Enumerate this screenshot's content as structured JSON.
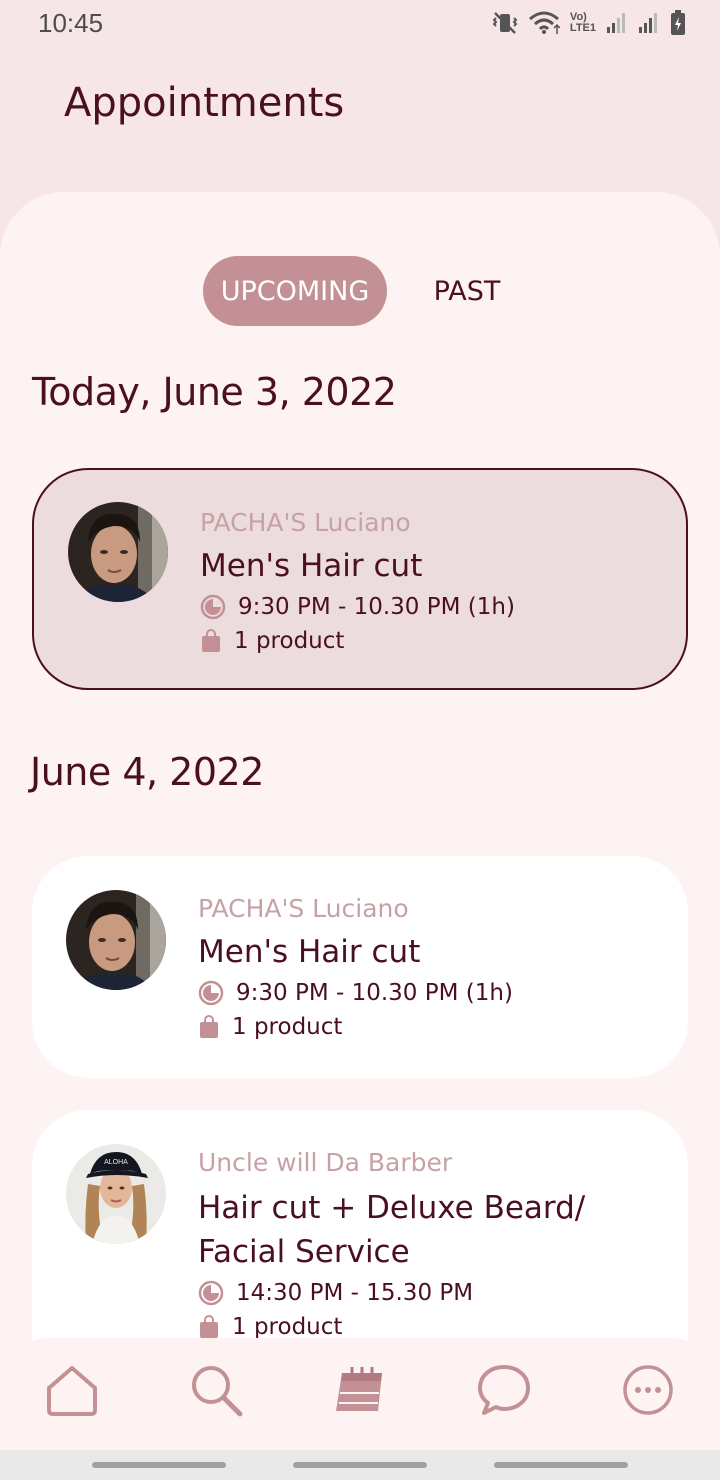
{
  "status_bar": {
    "time": "10:45",
    "icons": [
      "vibrate-icon",
      "wifi-icon",
      "volte-icon",
      "signal-icon",
      "signal-icon",
      "battery-icon"
    ],
    "volte_text_top": "Vo)",
    "volte_text_bottom": "LTE1"
  },
  "header": {
    "title": "Appointments"
  },
  "tabs": [
    {
      "label": "UPCOMING",
      "active": true
    },
    {
      "label": "PAST",
      "active": false
    }
  ],
  "sections": [
    {
      "date": "Today, June 3, 2022",
      "appointments": [
        {
          "provider": "PACHA'S Luciano",
          "service": "Men's Hair cut",
          "time": "9:30 PM - 10.30 PM (1h)",
          "products": "1 product",
          "selected": true
        }
      ]
    },
    {
      "date": "June 4, 2022",
      "appointments": [
        {
          "provider": "PACHA'S Luciano",
          "service": "Men's Hair cut",
          "time": "9:30 PM - 10.30 PM (1h)",
          "products": "1 product",
          "selected": false
        },
        {
          "provider": "Uncle will Da Barber",
          "service": "Hair cut + Deluxe Beard/ Facial Service",
          "time": "14:30 PM - 15.30 PM",
          "products": "1 product",
          "selected": false,
          "avatar_cap_text": "ALOHA"
        }
      ]
    }
  ],
  "bottom_nav": [
    {
      "icon": "home-icon"
    },
    {
      "icon": "search-icon"
    },
    {
      "icon": "calendar-icon",
      "active": true
    },
    {
      "icon": "chat-icon"
    },
    {
      "icon": "more-icon"
    }
  ],
  "colors": {
    "background": "#f6e6e7",
    "sheet": "#fdf3f3",
    "primary_text": "#4a0f22",
    "accent": "#c39195",
    "muted": "#c7a2a5",
    "selected_card": "#ecdcdd"
  }
}
